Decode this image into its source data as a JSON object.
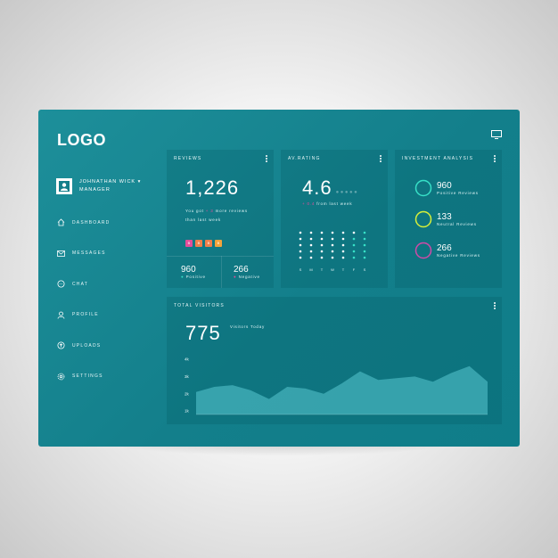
{
  "app": {
    "logo": "LOGO"
  },
  "user": {
    "name": "JOHNATHAN WICK ▾",
    "role": "MANAGER"
  },
  "nav": [
    {
      "label": "DASHBOARD",
      "icon": "home-icon"
    },
    {
      "label": "MESSAGES",
      "icon": "mail-icon"
    },
    {
      "label": "CHAT",
      "icon": "chat-icon"
    },
    {
      "label": "PROFILE",
      "icon": "user-icon"
    },
    {
      "label": "UPLOADS",
      "icon": "upload-icon"
    },
    {
      "label": "SETTINGS",
      "icon": "gear-icon"
    }
  ],
  "reviews": {
    "title": "REVIEWS",
    "value": "1,226",
    "line1_a": "You got",
    "line1_highlight": "+ 3",
    "line1_b": "more reviews",
    "line2": "than last week",
    "chips": [
      {
        "text": "B",
        "color": "#e24d9a"
      },
      {
        "text": "B",
        "color": "#f07f4a"
      },
      {
        "text": "B",
        "color": "#f07f4a"
      },
      {
        "text": "B",
        "color": "#f3a33c"
      }
    ],
    "positive_value": "960",
    "positive_label": "Positive",
    "negative_value": "266",
    "negative_label": "Negative"
  },
  "rating": {
    "title": "AV.RATING",
    "value": "4.6",
    "note_highlight": "+ 0.4",
    "note": "from last week",
    "days": [
      "S",
      "M",
      "T",
      "W",
      "T",
      "F",
      "S"
    ]
  },
  "investment": {
    "title": "INVESTMENT ANALYSIS",
    "items": [
      {
        "value": "960",
        "label": "Positive Reviews",
        "color": "#37e0c7"
      },
      {
        "value": "133",
        "label": "Neutral Reviews",
        "color": "#d7f03a"
      },
      {
        "value": "266",
        "label": "Negative Reviews",
        "color": "#d04aa8"
      }
    ]
  },
  "visitors": {
    "title": "TOTAL VISITORS",
    "value": "775",
    "caption": "Visitors Today"
  },
  "chart_data": {
    "type": "area",
    "title": "TOTAL VISITORS",
    "yticks": [
      "4k",
      "3k",
      "2k",
      "1k"
    ],
    "ylim": [
      0.8,
      4
    ],
    "values": [
      2.1,
      2.4,
      2.5,
      2.2,
      1.7,
      2.4,
      2.3,
      2.0,
      2.6,
      3.3,
      2.8,
      2.9,
      3.0,
      2.7,
      3.2,
      3.6,
      2.7
    ],
    "grid": false,
    "legend": "none"
  },
  "colors": {
    "panel": "#137f8b",
    "accent_pink": "#e24d9a",
    "accent_green": "#37e0c7",
    "accent_yellow": "#d7f03a"
  }
}
